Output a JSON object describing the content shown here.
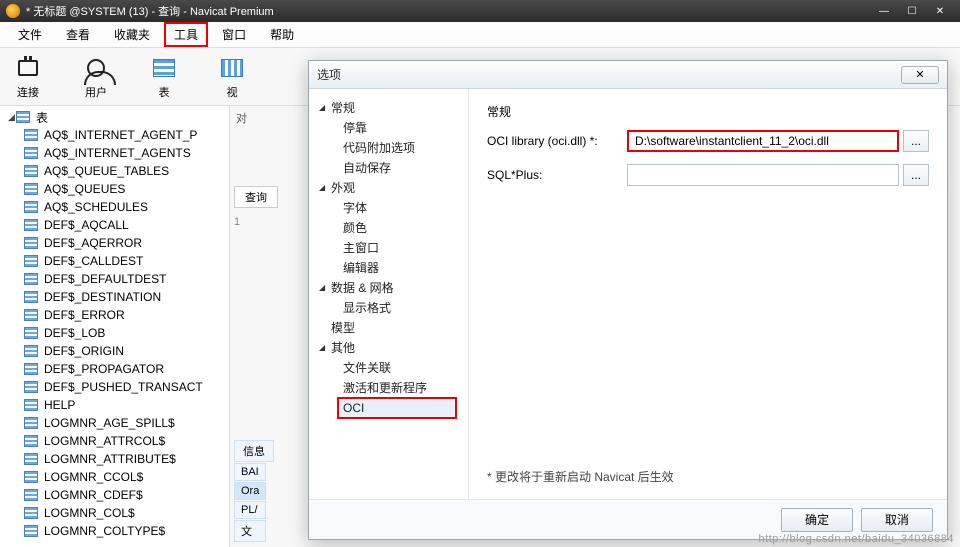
{
  "window": {
    "title": "* 无标题 @SYSTEM (13) - 查询 - Navicat Premium"
  },
  "menu": {
    "items": [
      "文件",
      "查看",
      "收藏夹",
      "工具",
      "窗口",
      "帮助"
    ],
    "highlighted_index": 3
  },
  "toolbar": {
    "connect": "连接",
    "user": "用户",
    "table": "表",
    "view_cut": "视"
  },
  "sidebar": {
    "root": "表",
    "items": [
      "AQ$_INTERNET_AGENT_P",
      "AQ$_INTERNET_AGENTS",
      "AQ$_QUEUE_TABLES",
      "AQ$_QUEUES",
      "AQ$_SCHEDULES",
      "DEF$_AQCALL",
      "DEF$_AQERROR",
      "DEF$_CALLDEST",
      "DEF$_DEFAULTDEST",
      "DEF$_DESTINATION",
      "DEF$_ERROR",
      "DEF$_LOB",
      "DEF$_ORIGIN",
      "DEF$_PROPAGATOR",
      "DEF$_PUSHED_TRANSACT",
      "HELP",
      "LOGMNR_AGE_SPILL$",
      "LOGMNR_ATTRCOL$",
      "LOGMNR_ATTRIBUTE$",
      "LOGMNR_CCOL$",
      "LOGMNR_CDEF$",
      "LOGMNR_COL$",
      "LOGMNR_COLTYPE$"
    ]
  },
  "tabs": {
    "query": "查询",
    "info": "信息",
    "obj_cut": "对"
  },
  "result_tags": [
    "BAI",
    "Ora",
    "PL/",
    "文"
  ],
  "result_selected": 1,
  "line_no": "1",
  "dialog": {
    "title": "选项",
    "nav": {
      "general": "常规",
      "general_children": [
        "停靠",
        "代码附加选项",
        "自动保存"
      ],
      "appearance": "外观",
      "appearance_children": [
        "字体",
        "颜色",
        "主窗口",
        "编辑器"
      ],
      "data": "数据 & 网格",
      "data_children": [
        "显示格式"
      ],
      "model": "模型",
      "other": "其他",
      "other_children": [
        "文件关联",
        "激活和更新程序",
        "OCI"
      ]
    },
    "pane": {
      "section": "常规",
      "oci_label": "OCI library (oci.dll) *:",
      "oci_value": "D:\\software\\instantclient_11_2\\oci.dll",
      "sqlplus_label": "SQL*Plus:",
      "sqlplus_value": "",
      "browse": "...",
      "note": "* 更改将于重新启动 Navicat 后生效"
    },
    "buttons": {
      "ok": "确定",
      "cancel": "取消"
    }
  },
  "watermark": "http://blog.csdn.net/baidu_34036884"
}
